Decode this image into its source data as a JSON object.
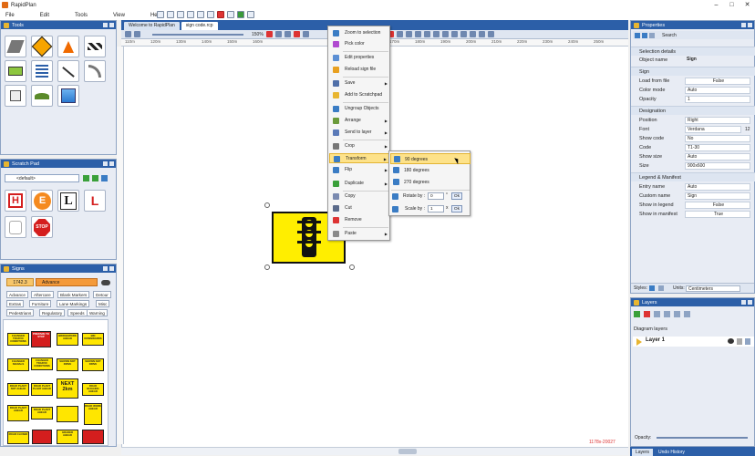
{
  "app": {
    "title": "RapidPlan"
  },
  "menu": [
    "File",
    "Edit",
    "Tools",
    "View",
    "Help"
  ],
  "tools_panel": {
    "title": "Tools"
  },
  "scratch_panel": {
    "title": "Scratch Pad",
    "dropdown": "<default>"
  },
  "signs_panel": {
    "title": "Signs",
    "code_tab": "1742.3",
    "category_tab": "Advance",
    "categories": [
      "Advance",
      "Aftercare",
      "Blank Markers",
      "Detour",
      "Extras",
      "Furniture",
      "Lane Markings",
      "Misc",
      "Pedestrians",
      "Regulatory",
      "Speeds",
      "Warning"
    ],
    "signs": [
      {
        "text": "CHANGED TRAFFIC CONDITIONS"
      },
      {
        "text": "PREPARE TO STOP"
      },
      {
        "text": "BRIDGEWORK AHEAD"
      },
      {
        "text": "BIN DOWNWARDS"
      },
      {
        "text": "CHANGED SIGNALS"
      },
      {
        "text": "CHANGED TRAFFIC CONDITIONS"
      },
      {
        "text": "SHOWN NOT DRIVE"
      },
      {
        "text": "SHOWN NOT DRIVE"
      },
      {
        "text": "ROAD PLANT NOT AHEAD"
      },
      {
        "text": "ROAD PLANT PLANT AHEAD"
      },
      {
        "text": "ROAD BUGGING AHEAD"
      },
      {
        "text": "NEXT 2km"
      },
      {
        "text": "ROAD PLANT AHEAD"
      },
      {
        "text": "ROAD PLANT AHEAD"
      },
      {
        "text": "ROAD WORK AHEAD"
      },
      {
        "text": "ROAD CLOSED"
      },
      {
        "text": "GRADER AHEAD"
      }
    ]
  },
  "doc_tabs": [
    "Welcome to RapidPlan",
    "sign code.rcp"
  ],
  "zoom": "150%",
  "ruler_marks": [
    "110m",
    "120m",
    "130m",
    "140m",
    "150m",
    "160m",
    "170m",
    "180m",
    "190m",
    "200m",
    "210m",
    "220m",
    "230m",
    "240m",
    "250m",
    "260m",
    "270m",
    "280m",
    "290m",
    "300m"
  ],
  "canvas": {
    "coords": "1178x-20027"
  },
  "context_menu": [
    {
      "label": "Zoom to selection"
    },
    {
      "label": "Pick color"
    },
    {
      "label": "Edit properties"
    },
    {
      "label": "Reload sign file"
    },
    {
      "label": "Save",
      "submenu": true
    },
    {
      "label": "Add to Scratchpad"
    },
    {
      "label": "Ungroup Objects"
    },
    {
      "label": "Arrange",
      "submenu": true
    },
    {
      "label": "Send to layer",
      "submenu": true
    },
    {
      "label": "Crop",
      "submenu": true
    },
    {
      "label": "Transform",
      "submenu": true,
      "highlighted": true
    },
    {
      "label": "Flip",
      "submenu": true
    },
    {
      "label": "Duplicate",
      "submenu": true
    },
    {
      "label": "Copy"
    },
    {
      "label": "Cut"
    },
    {
      "label": "Remove"
    },
    {
      "label": "Paste",
      "submenu": true
    }
  ],
  "transform_menu": {
    "items": [
      "90 degrees",
      "180 degrees",
      "270 degrees"
    ],
    "rotate_label": "Rotate by :",
    "rotate_value": "0",
    "rotate_unit": "°",
    "scale_label": "Scale by :",
    "scale_value": "1",
    "scale_unit": "x",
    "ok": "Ok"
  },
  "properties": {
    "title": "Properties",
    "search": "Search",
    "selection_details": "Selection details",
    "object_name_label": "Object name",
    "object_name": "Sign",
    "sign_section": "Sign",
    "load_from_file_label": "Load from file",
    "load_from_file": "False",
    "color_mode_label": "Color mode",
    "color_mode": "Auto",
    "opacity_label": "Opacity",
    "opacity": "1",
    "designation_section": "Designation",
    "position_label": "Position",
    "position": "Right",
    "font_label": "Font",
    "font": "Verdana",
    "font_size": "12",
    "show_code_label": "Show code",
    "show_code": "No",
    "code_label": "Code",
    "code": "T1-30",
    "show_size_label": "Show size",
    "show_size": "Auto",
    "size_label": "Size",
    "size": "900x600",
    "legend_section": "Legend & Manifest",
    "entry_name_label": "Entry name",
    "entry_name": "Auto",
    "custom_name_label": "Custom name",
    "custom_name": "Sign",
    "show_in_legend_label": "Show in legend",
    "show_in_legend": "False",
    "show_in_manifest_label": "Show in manifest",
    "show_in_manifest": "True",
    "styles_label": "Styles:",
    "units_label": "Units:",
    "units": "Centimeters"
  },
  "layers": {
    "title": "Layers",
    "diagram_layers": "Diagram layers",
    "layer_name": "Layer 1",
    "opacity_label": "Opacity:"
  },
  "bottom_tabs": [
    "Layers",
    "Undo History"
  ],
  "colors": {
    "accent": "#2c5fa8",
    "highlight": "#fde28a",
    "sign_yellow": "#ffe600"
  }
}
